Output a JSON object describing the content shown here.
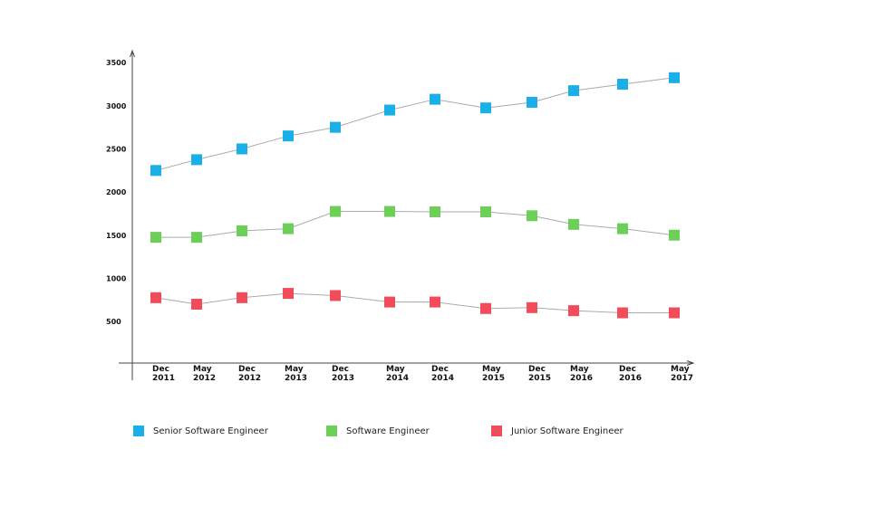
{
  "chart_data": {
    "type": "line",
    "title": "",
    "xlabel": "",
    "ylabel": "",
    "ylim": [
      0,
      3500
    ],
    "yticks": [
      500,
      1000,
      1500,
      2000,
      2500,
      3000,
      3500
    ],
    "grid": false,
    "legend_position": "bottom",
    "categories": [
      [
        "Dec",
        "2011"
      ],
      [
        "May",
        "2012"
      ],
      [
        "Dec",
        "2012"
      ],
      [
        "May",
        "2013"
      ],
      [
        "Dec",
        "2013"
      ],
      [
        "May",
        "2014"
      ],
      [
        "Dec",
        "2014"
      ],
      [
        "May",
        "2015"
      ],
      [
        "Dec",
        "2015"
      ],
      [
        "May",
        "2016"
      ],
      [
        "Dec",
        "2016"
      ],
      [
        "May",
        "2017"
      ]
    ],
    "series": [
      {
        "name": "Senior Software Engineer",
        "color": "#1AAFE6",
        "values": [
          2250,
          2375,
          2500,
          2650,
          2750,
          2950,
          3075,
          2975,
          3040,
          3175,
          3250,
          3325
        ]
      },
      {
        "name": "Software Engineer",
        "color": "#6CCF57",
        "values": [
          1475,
          1475,
          1550,
          1575,
          1775,
          1775,
          1770,
          1770,
          1725,
          1625,
          1575,
          1500
        ]
      },
      {
        "name": "Junior Software Engineer",
        "color": "#F24B5A",
        "values": [
          775,
          700,
          775,
          825,
          800,
          725,
          725,
          650,
          660,
          625,
          600,
          600
        ]
      }
    ]
  }
}
